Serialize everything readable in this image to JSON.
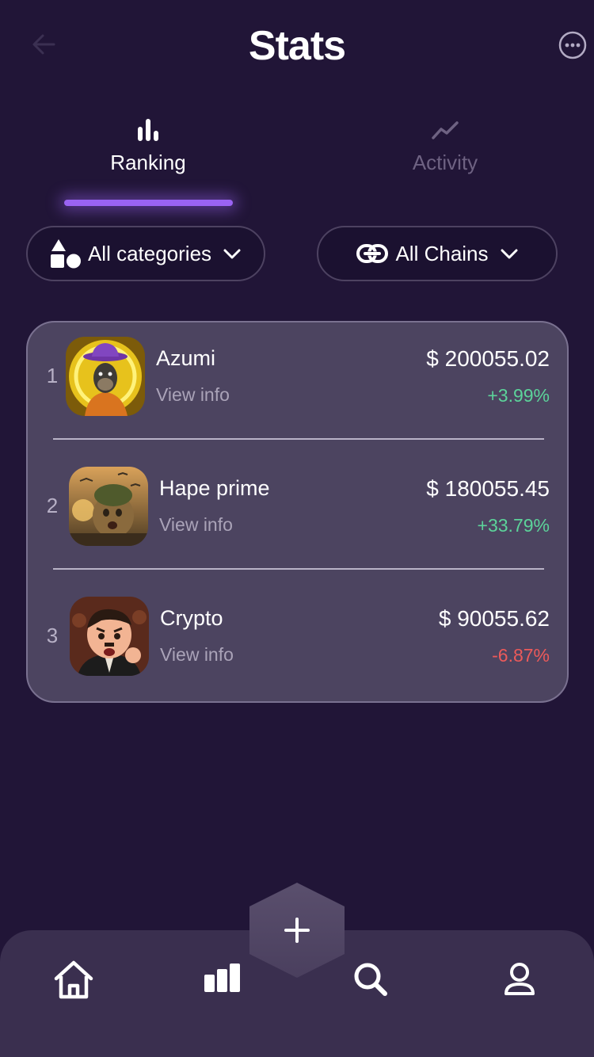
{
  "header": {
    "title": "Stats",
    "back_icon": "arrow-left-icon",
    "more_icon": "more-horizontal-icon"
  },
  "tabs": [
    {
      "label": "Ranking",
      "icon": "bar-chart-icon",
      "active": true
    },
    {
      "label": "Activity",
      "icon": "trend-line-icon",
      "active": false
    }
  ],
  "filters": {
    "categories": {
      "label": "All categories",
      "icon": "shapes-icon"
    },
    "chains": {
      "label": "All Chains",
      "icon": "link-icon"
    }
  },
  "ranking": [
    {
      "rank": "1",
      "name": "Azumi",
      "link": "View info",
      "price": "$ 200055.02",
      "change": "+3.99%",
      "trend": "up"
    },
    {
      "rank": "2",
      "name": "Hape prime",
      "link": "View info",
      "price": "$ 180055.45",
      "change": "+33.79%",
      "trend": "up"
    },
    {
      "rank": "3",
      "name": "Crypto",
      "link": "View info",
      "price": "$ 90055.62",
      "change": "-6.87%",
      "trend": "down"
    }
  ],
  "bottom_nav": {
    "items": [
      "home-icon",
      "stats-icon",
      "search-icon",
      "profile-icon"
    ],
    "fab_icon": "plus-icon"
  },
  "colors": {
    "background": "#211537",
    "accent": "#9a63f2",
    "card": "#4c4460",
    "positive": "#5cd39a",
    "negative": "#ec5a5a"
  }
}
